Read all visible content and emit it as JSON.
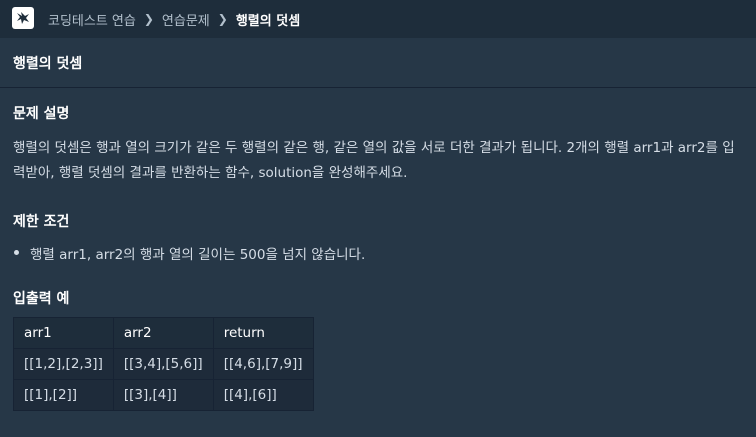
{
  "breadcrumb": {
    "items": [
      "코딩테스트 연습",
      "연습문제"
    ],
    "current": "행렬의 덧셈"
  },
  "title": "행렬의 덧셈",
  "description": {
    "heading": "문제 설명",
    "text": "행렬의 덧셈은 행과 열의 크기가 같은 두 행렬의 같은 행, 같은 열의 값을 서로 더한 결과가 됩니다. 2개의 행렬 arr1과 arr2를 입력받아, 행렬 덧셈의 결과를 반환하는 함수, solution을 완성해주세요."
  },
  "constraints": {
    "heading": "제한 조건",
    "items": [
      "행렬 arr1, arr2의 행과 열의 길이는 500을 넘지 않습니다."
    ]
  },
  "examples": {
    "heading": "입출력 예",
    "columns": [
      "arr1",
      "arr2",
      "return"
    ],
    "rows": [
      [
        "[[1,2],[2,3]]",
        "[[3,4],[5,6]]",
        "[[4,6],[7,9]]"
      ],
      [
        "[[1],[2]]",
        "[[3],[4]]",
        "[[4],[6]]"
      ]
    ]
  },
  "colors": {
    "background": "#263747",
    "topbar": "#1e2d3b",
    "text": "#d5dde6",
    "heading": "#ffffff"
  }
}
